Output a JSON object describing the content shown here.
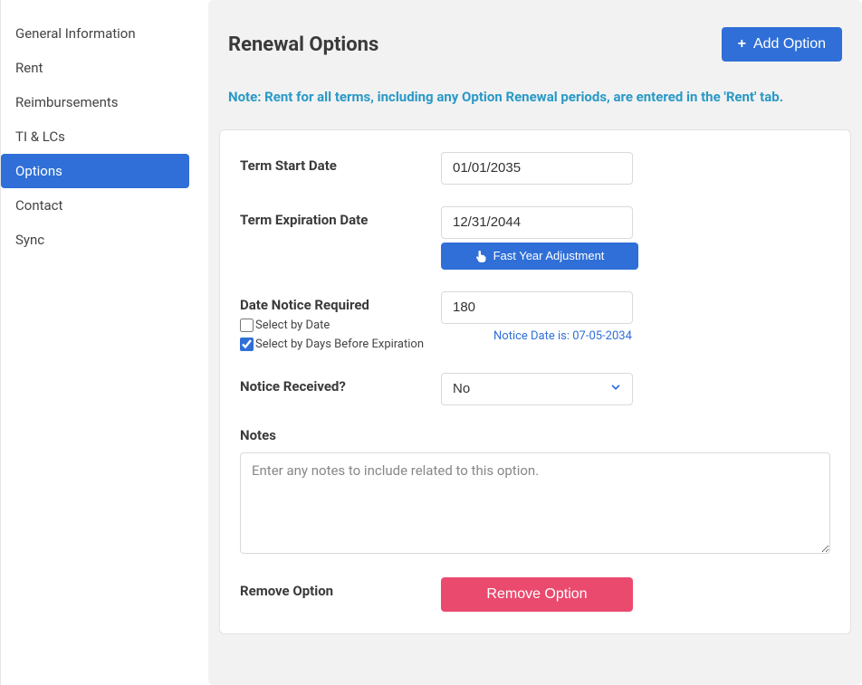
{
  "sidebar": {
    "items": [
      {
        "label": "General Information"
      },
      {
        "label": "Rent"
      },
      {
        "label": "Reimbursements"
      },
      {
        "label": "TI & LCs"
      },
      {
        "label": "Options"
      },
      {
        "label": "Contact"
      },
      {
        "label": "Sync"
      }
    ],
    "activeIndex": 4
  },
  "header": {
    "title": "Renewal Options",
    "addButton": "Add Option"
  },
  "note": "Note: Rent for all terms, including any Option Renewal periods, are entered in the 'Rent' tab.",
  "option": {
    "termStart": {
      "label": "Term Start Date",
      "value": "01/01/2035"
    },
    "termExpiration": {
      "label": "Term Expiration Date",
      "value": "12/31/2044"
    },
    "fastYearButton": "Fast Year Adjustment",
    "dateNotice": {
      "label": "Date Notice Required",
      "value": "180",
      "selectByDate": {
        "label": "Select by Date",
        "checked": false
      },
      "selectByDays": {
        "label": "Select by Days Before Expiration",
        "checked": true
      },
      "noticeDateText": "Notice Date is: 07-05-2034"
    },
    "noticeReceived": {
      "label": "Notice Received?",
      "value": "No"
    },
    "notes": {
      "label": "Notes",
      "placeholder": "Enter any notes to include related to this option.",
      "value": ""
    },
    "remove": {
      "label": "Remove Option",
      "button": "Remove Option"
    }
  }
}
